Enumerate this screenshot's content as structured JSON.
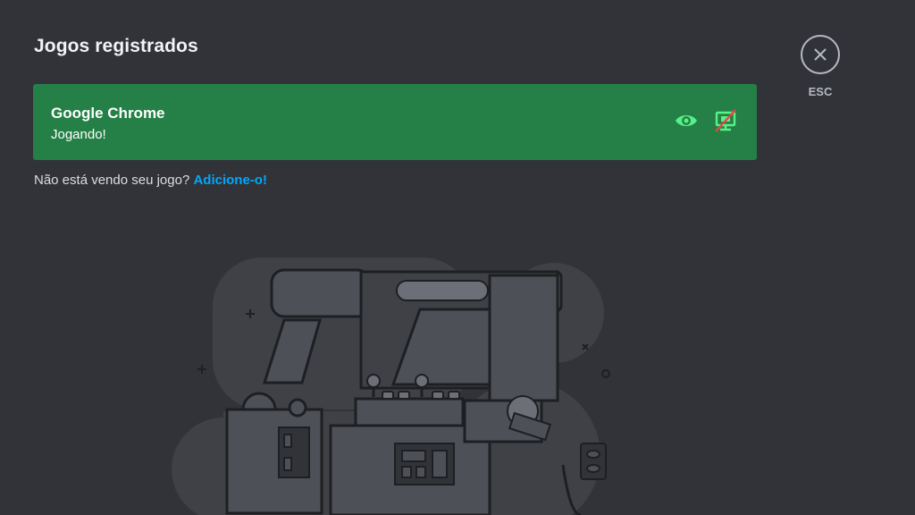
{
  "page": {
    "title": "Jogos registrados"
  },
  "game": {
    "name": "Google Chrome",
    "status": "Jogando!",
    "eye_icon": "eye-icon",
    "overlay_icon": "overlay-disabled-icon"
  },
  "hint": {
    "text": "Não está vendo seu jogo? ",
    "link": "Adicione-o!"
  },
  "close": {
    "icon": "close-icon",
    "label": "ESC"
  },
  "colors": {
    "background": "#313338",
    "card": "#248046",
    "link": "#00a8fc",
    "icon_green": "#57f287",
    "icon_red": "#ed4245"
  }
}
